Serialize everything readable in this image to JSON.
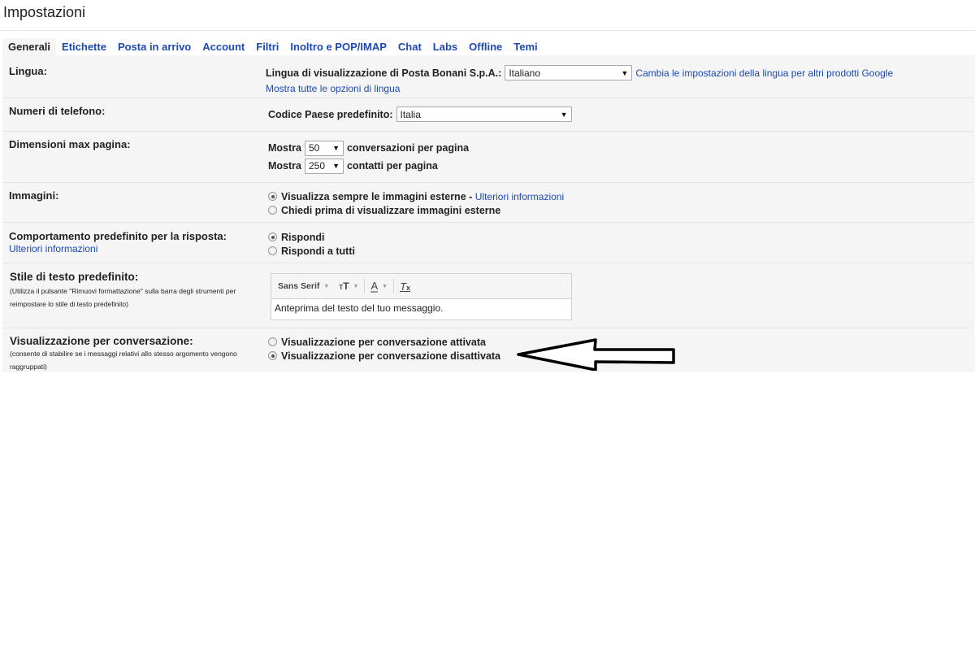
{
  "header": {
    "title": "Impostazioni"
  },
  "tabs": [
    {
      "label": "Generali",
      "active": true
    },
    {
      "label": "Etichette"
    },
    {
      "label": "Posta in arrivo"
    },
    {
      "label": "Account"
    },
    {
      "label": "Filtri"
    },
    {
      "label": "Inoltro e POP/IMAP"
    },
    {
      "label": "Chat"
    },
    {
      "label": "Labs"
    },
    {
      "label": "Offline"
    },
    {
      "label": "Temi"
    }
  ],
  "settings": {
    "language": {
      "label": "Lingua:",
      "display_label": "Lingua di visualizzazione di Posta Bonani S.p.A.:",
      "selected": "Italiano",
      "change_link": "Cambia le impostazioni della lingua per altri prodotti Google",
      "show_all_link": "Mostra tutte le opzioni di lingua"
    },
    "phone": {
      "label": "Numeri di telefono:",
      "country_label": "Codice Paese predefinito:",
      "selected": "Italia"
    },
    "page_size": {
      "label": "Dimensioni max pagina:",
      "show_label": "Mostra",
      "conversations_value": "50",
      "conversations_suffix": "conversazioni per pagina",
      "contacts_value": "250",
      "contacts_suffix": "contatti per pagina"
    },
    "images": {
      "label": "Immagini:",
      "options": [
        {
          "label": "Visualizza sempre le immagini esterne",
          "checked": true
        },
        {
          "label": "Chiedi prima di visualizzare immagini esterne",
          "checked": false
        }
      ],
      "separator": " - ",
      "more_info_link": "Ulteriori informazioni"
    },
    "reply": {
      "label": "Comportamento predefinito per la risposta:",
      "more_info_link": "Ulteriori informazioni",
      "options": [
        {
          "label": "Rispondi",
          "checked": true
        },
        {
          "label": "Rispondi a tutti",
          "checked": false
        }
      ]
    },
    "text_style": {
      "label": "Stile di testo predefinito:",
      "note": "(Utilizza il pulsante \"Rimuovi formattazione\" sulla barra degli strumenti per reimpostare lo stile di testo predefinito)",
      "font": "Sans Serif",
      "size_icon": "ⱺT",
      "color_icon": "A",
      "clear_icon": "T",
      "preview": "Anteprima del testo del tuo messaggio."
    },
    "conversation_view": {
      "label": "Visualizzazione per conversazione:",
      "note": "(consente di stabilire se i messaggi relativi allo stesso argomento vengono raggruppati)",
      "options": [
        {
          "label": "Visualizzazione per conversazione attivata",
          "checked": false
        },
        {
          "label": "Visualizzazione per conversazione disattivata",
          "checked": true
        }
      ]
    }
  },
  "annotation": {
    "icon": "arrow-left-icon"
  }
}
